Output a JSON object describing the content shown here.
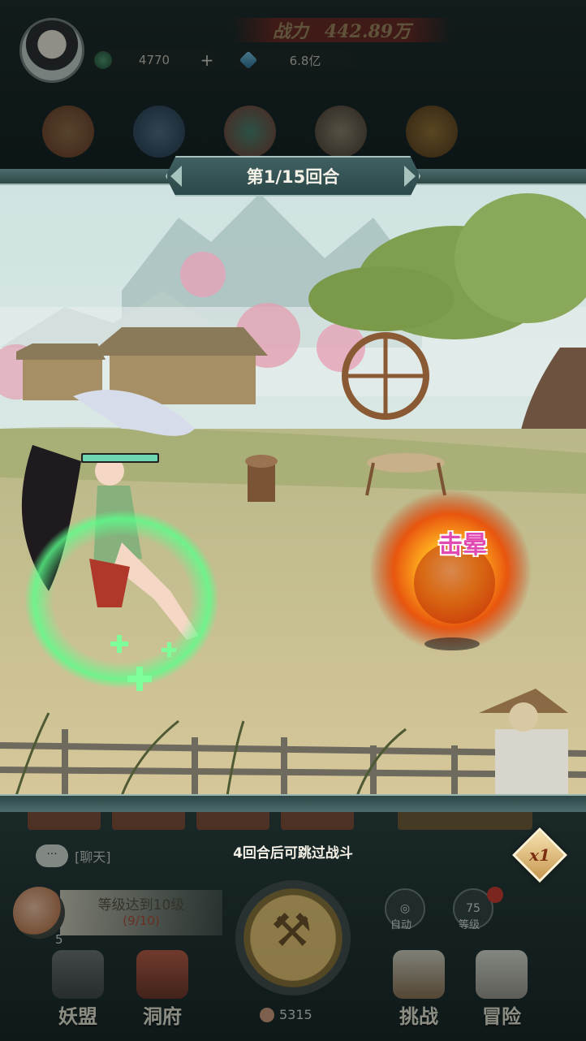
{
  "top_hud": {
    "power_label": "战力",
    "power_value": "442.89万",
    "jade_value": "4770",
    "jade_plus": "+",
    "crystal_value": "6.8亿"
  },
  "battle": {
    "round_text": "第1/15回合",
    "effect_text": "击晕"
  },
  "bottom_hud": {
    "skip_hint": "4回合后可跳过战斗",
    "chat_icon_text": "···",
    "chat_label": "[聊天]",
    "speed_label": "x1",
    "quest_title": "等级达到10级",
    "quest_progress": "(9/10)",
    "peach_count": "5",
    "auto_label": "自动",
    "level_value": "75",
    "level_label": "等级",
    "coin_value": "5315",
    "nav": [
      "妖盟",
      "洞府",
      "挑战",
      "冒险"
    ]
  }
}
